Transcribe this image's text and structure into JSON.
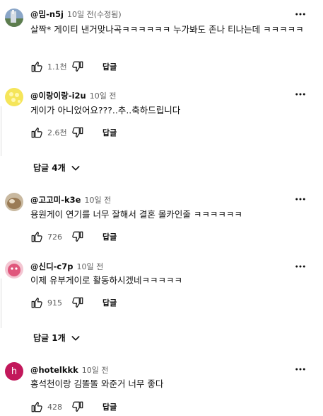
{
  "comments": [
    {
      "author": "@밈-n5j",
      "time": "10일 전(수정됨)",
      "text": "살짝* 게이티 낸거맞나곡ㅋㅋㅋㅋㅋㅋ 누가봐도 존나 티나는데 ㅋㅋㅋㅋㅋ",
      "likes": "1.1천",
      "reply_label": "답글"
    },
    {
      "author": "@이랑이랑-i2u",
      "time": "10일 전",
      "text": "게이가 아니었어요???..추..축하드립니다",
      "likes": "2.6천",
      "reply_label": "답글",
      "replies_toggle": "답글 4개"
    },
    {
      "author": "@고고미-k3e",
      "time": "10일 전",
      "text": "용원게이 연기를 너무 잘해서 결혼 몰카인줄 ㅋㅋㅋㅋㅋㅋ",
      "likes": "726",
      "reply_label": "답글"
    },
    {
      "author": "@신디-c7p",
      "time": "10일 전",
      "text": "이제 유부게이로 활동하시겠네ㅋㅋㅋㅋㅋ",
      "likes": "915",
      "reply_label": "답글",
      "replies_toggle": "답글 1개"
    },
    {
      "author": "@hotelkkk",
      "time": "10일 전",
      "text": "홍석천이랑 김똘똘 와준거 너무 좋다",
      "likes": "428",
      "reply_label": "답글",
      "avatar_letter": "h"
    }
  ],
  "icons": {
    "like": "thumb-up-icon",
    "dislike": "thumb-down-icon",
    "menu": "more-vertical-icon",
    "expand": "chevron-down-icon"
  },
  "colors": {
    "avatar_h": "#c2185b",
    "meta": "#606060"
  }
}
